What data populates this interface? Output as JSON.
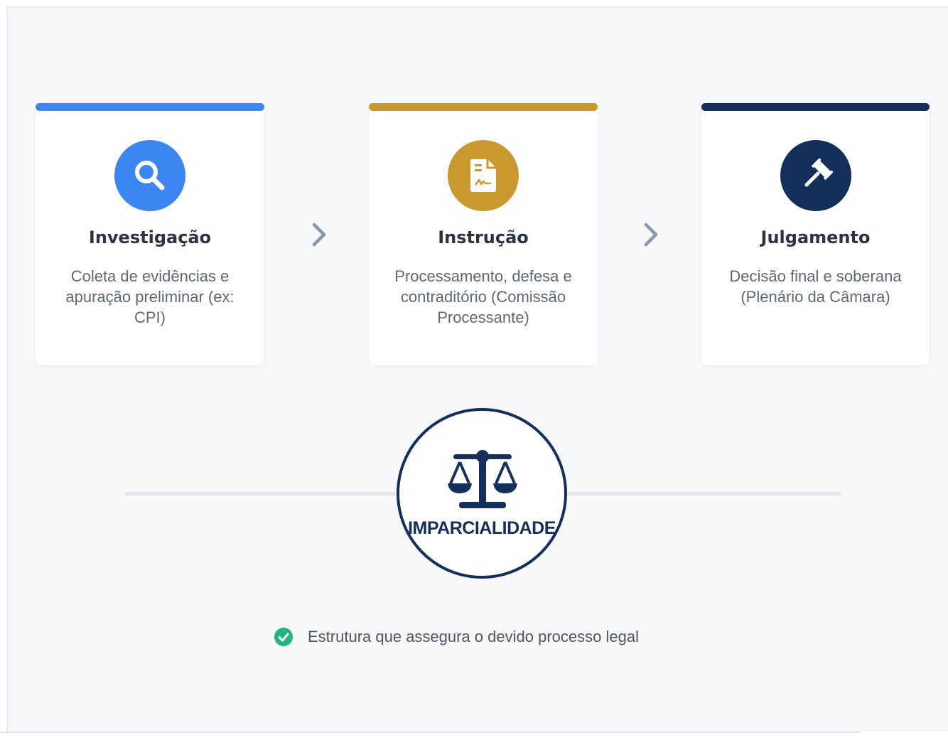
{
  "stages": [
    {
      "title": "Investigação",
      "description": "Coleta de evidências e apuração preliminar (ex: CPI)",
      "icon": "magnifier-icon",
      "color": "#3b86f0"
    },
    {
      "title": "Instrução",
      "description": "Processamento, defesa e contraditório (Comissão Processante)",
      "icon": "signed-document-icon",
      "color": "#c9982f"
    },
    {
      "title": "Julgamento",
      "description": "Decisão final e soberana (Plenário da Câmara)",
      "icon": "gavel-icon",
      "color": "#142f59"
    }
  ],
  "connector_icon": "chevron-right-icon",
  "center_badge": {
    "label": "IMPARCIALIDADE",
    "icon": "scales-icon",
    "color": "#142f59"
  },
  "footer": {
    "text": "Estrutura que assegura o devido processo legal",
    "icon": "check-circle-icon",
    "icon_color": "#21b57c"
  }
}
